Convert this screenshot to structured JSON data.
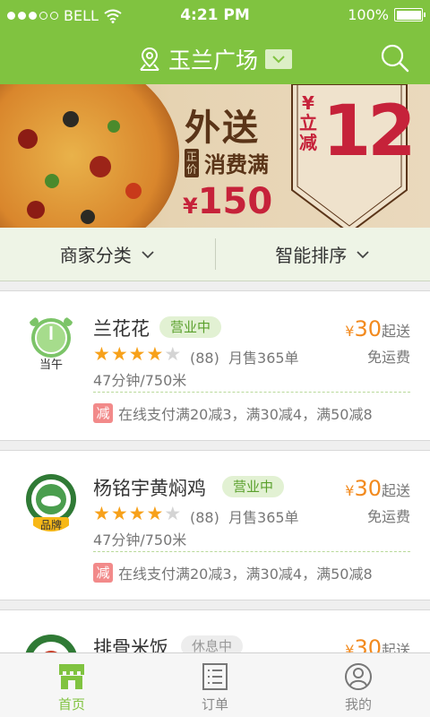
{
  "status_bar": {
    "carrier": "BELL",
    "time": "4:21 PM",
    "battery": "100%"
  },
  "nav": {
    "location": "玉兰广场",
    "icons": [
      "location-icon",
      "dropdown-arrow-icon",
      "search-icon"
    ]
  },
  "banner": {
    "title": "外送",
    "zhengjia": "正价",
    "subtitle": "消费满",
    "yen": "¥",
    "amount": "150",
    "badge_yen": "¥",
    "badge_text_1": "立",
    "badge_text_2": "减",
    "badge_num": "12"
  },
  "filters": {
    "category": "商家分类",
    "sort": "智能排序"
  },
  "shops": [
    {
      "name": "兰花花",
      "status": "营业中",
      "logo_text": "当午",
      "rating_count": "(88)",
      "sales": "月售365单",
      "meta": "47分钟/750米",
      "price_yen": "¥",
      "price": "30",
      "price_tail": "起送",
      "delivery": "免运费",
      "promo_badge": "减",
      "promo": "在线支付满20减3，满30减4，满50减8"
    },
    {
      "name": "杨铭宇黄焖鸡",
      "status": "营业中",
      "logo_text": "品牌",
      "rating_count": "(88)",
      "sales": "月售365单",
      "meta": "47分钟/750米",
      "price_yen": "¥",
      "price": "30",
      "price_tail": "起送",
      "delivery": "免运费",
      "promo_badge": "减",
      "promo": "在线支付满20减3，满30减4，满50减8"
    },
    {
      "name": "排骨米饭",
      "status": "休息中",
      "price_yen": "¥",
      "price": "30",
      "price_tail": "起送"
    }
  ],
  "tabs": [
    {
      "label": "首页",
      "icon": "home-store-icon"
    },
    {
      "label": "订单",
      "icon": "orders-list-icon"
    },
    {
      "label": "我的",
      "icon": "profile-icon"
    }
  ],
  "colors": {
    "brand_green": "#80c340",
    "price_orange": "#f28a1e",
    "star": "#f7a11a"
  }
}
